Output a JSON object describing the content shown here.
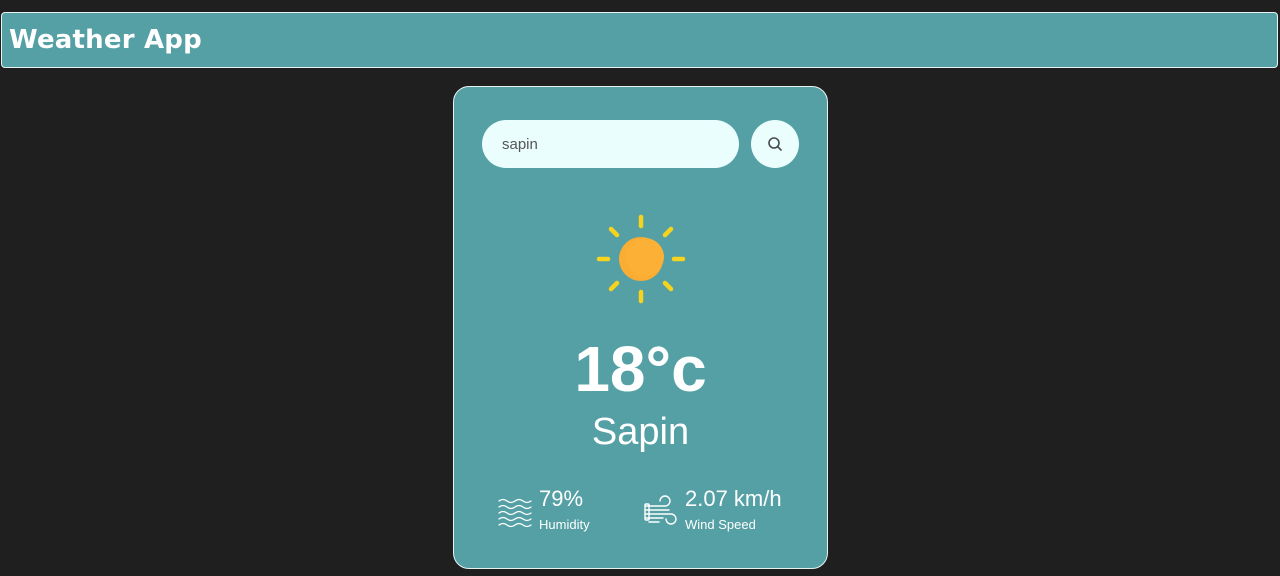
{
  "header": {
    "title": "Weather App"
  },
  "search": {
    "value": "sapin"
  },
  "weather": {
    "condition_icon": "sun-icon",
    "temperature": "18°c",
    "city": "Sapin"
  },
  "details": {
    "humidity": {
      "value": "79%",
      "label": "Humidity",
      "icon": "humidity-waves-icon"
    },
    "wind": {
      "value": "2.07 km/h",
      "label": "Wind Speed",
      "icon": "wind-icon"
    }
  },
  "colors": {
    "page_background": "#201f20",
    "panel": "#54a0a5",
    "input_background": "#e9fefd",
    "sun": "#fbac33",
    "sun_rays": "#f6d31c"
  }
}
